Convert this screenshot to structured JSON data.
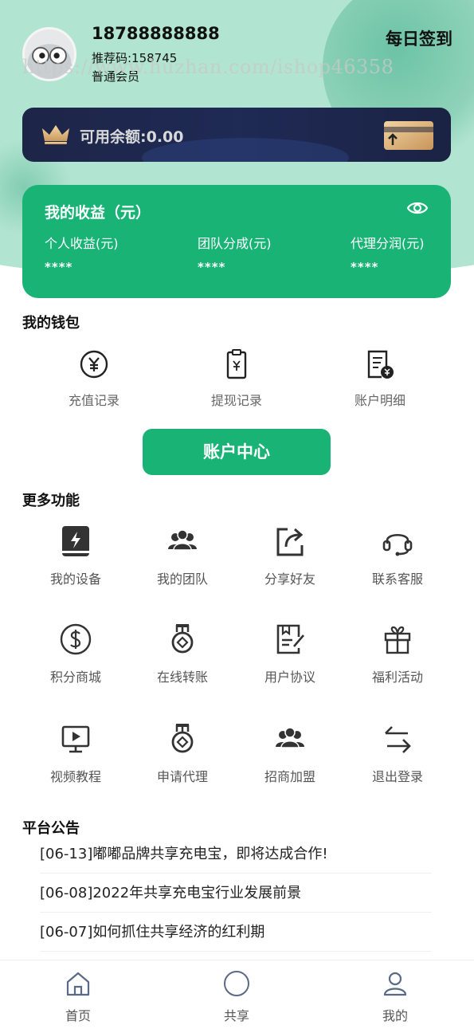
{
  "profile": {
    "phone": "18788888888",
    "referral_code": "推荐码:158745",
    "member_level": "普通会员",
    "checkin_label": "每日签到",
    "watermark": "https://www.huzhan.com/ishop46358"
  },
  "balance": {
    "label": "可用余额:0.00"
  },
  "earnings": {
    "title": "我的收益（元）",
    "columns": [
      {
        "label": "个人收益(元)",
        "value": "****"
      },
      {
        "label": "团队分成(元)",
        "value": "****"
      },
      {
        "label": "代理分润(元)",
        "value": "****"
      }
    ]
  },
  "wallet": {
    "title": "我的钱包",
    "items": [
      {
        "label": "充值记录",
        "icon": "yuan-circle-icon"
      },
      {
        "label": "提现记录",
        "icon": "clipboard-yuan-icon"
      },
      {
        "label": "账户明细",
        "icon": "document-yuan-icon"
      }
    ]
  },
  "account_center_label": "账户中心",
  "more": {
    "title": "更多功能",
    "items": [
      {
        "label": "我的设备",
        "icon": "device-icon"
      },
      {
        "label": "我的团队",
        "icon": "team-icon"
      },
      {
        "label": "分享好友",
        "icon": "share-icon"
      },
      {
        "label": "联系客服",
        "icon": "headset-icon"
      },
      {
        "label": "积分商城",
        "icon": "dollar-circle-icon"
      },
      {
        "label": "在线转账",
        "icon": "medal-icon"
      },
      {
        "label": "用户协议",
        "icon": "agreement-icon"
      },
      {
        "label": "福利活动",
        "icon": "gift-icon"
      },
      {
        "label": "视频教程",
        "icon": "video-icon"
      },
      {
        "label": "申请代理",
        "icon": "medal-icon"
      },
      {
        "label": "招商加盟",
        "icon": "team-icon"
      },
      {
        "label": "退出登录",
        "icon": "swap-arrows-icon"
      }
    ]
  },
  "notices": {
    "title": "平台公告",
    "items": [
      "[06-13]嘟嘟品牌共享充电宝，即将达成合作!",
      "[06-08]2022年共享充电宝行业发展前景",
      "[06-07]如何抓住共享经济的红利期"
    ]
  },
  "tabbar": {
    "items": [
      {
        "label": "首页",
        "icon": "home-icon"
      },
      {
        "label": "共享",
        "icon": "circle-icon"
      },
      {
        "label": "我的",
        "icon": "user-icon"
      }
    ]
  },
  "colors": {
    "primary_green": "#18b375",
    "hero_bg": "#b1e4d1",
    "balance_card": "#1d2547",
    "gold": "#d9b07a"
  }
}
